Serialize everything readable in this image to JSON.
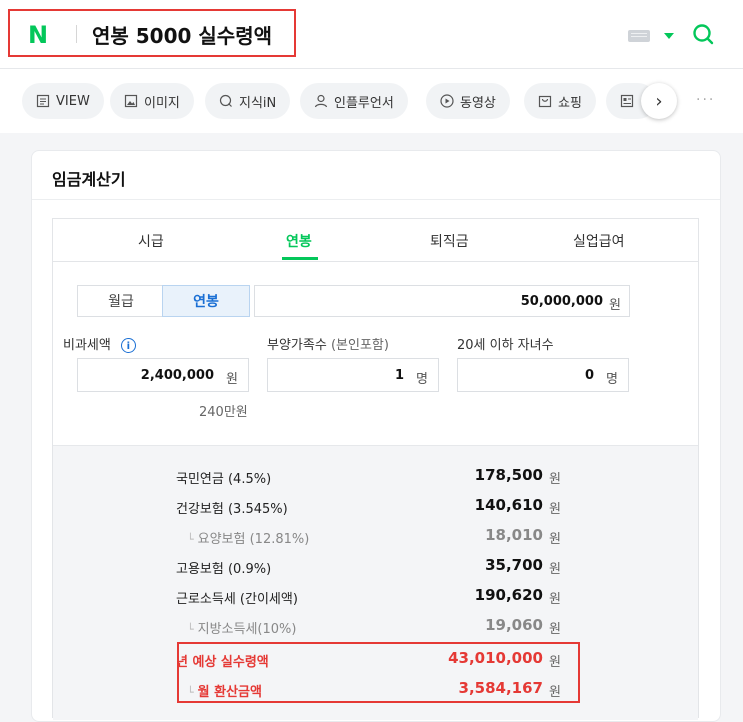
{
  "header": {
    "logo": "N",
    "query": "연봉 5000 실수령액",
    "colors": {
      "brand": "#03c75a",
      "highlight": "#e53935"
    }
  },
  "tabs": [
    {
      "label": "VIEW",
      "icon": "document-icon"
    },
    {
      "label": "이미지",
      "icon": "image-icon"
    },
    {
      "label": "지식iN",
      "icon": "q-icon"
    },
    {
      "label": "인플루언서",
      "icon": "person-icon"
    },
    {
      "label": "동영상",
      "icon": "play-icon"
    },
    {
      "label": "쇼핑",
      "icon": "bag-icon"
    }
  ],
  "more_label": "···",
  "card": {
    "title": "임금계산기",
    "calc_tabs": [
      "시급",
      "연봉",
      "퇴직금",
      "실업급여"
    ],
    "active_calc_tab": "연봉",
    "segments": [
      "월급",
      "연봉"
    ],
    "active_segment": "연봉",
    "salary": {
      "value": "50,000,000",
      "unit": "원"
    },
    "fields": {
      "nontax": {
        "label": "비과세액",
        "value": "2,400,000",
        "unit": "원",
        "hint": "240만원"
      },
      "dependents": {
        "label": "부양가족수",
        "sublabel": "(본인포함)",
        "value": "1",
        "unit": "명"
      },
      "children": {
        "label": "20세 이하 자녀수",
        "value": "0",
        "unit": "명"
      }
    },
    "results": [
      {
        "label": "국민연금 (4.5%)",
        "value": "178,500",
        "unit": "원"
      },
      {
        "label": "건강보험 (3.545%)",
        "value": "140,610",
        "unit": "원"
      },
      {
        "label": "요양보험 (12.81%)",
        "value": "18,010",
        "unit": "원",
        "sub": true
      },
      {
        "label": "고용보험 (0.9%)",
        "value": "35,700",
        "unit": "원"
      },
      {
        "label": "근로소득세 (간이세액)",
        "value": "190,620",
        "unit": "원"
      },
      {
        "label": "지방소득세(10%)",
        "value": "19,060",
        "unit": "원",
        "sub": true
      }
    ],
    "summary": [
      {
        "label": "년 예상 실수령액",
        "value": "43,010,000",
        "unit": "원"
      },
      {
        "label": "월 환산금액",
        "value": "3,584,167",
        "unit": "원",
        "sub": true
      }
    ]
  }
}
